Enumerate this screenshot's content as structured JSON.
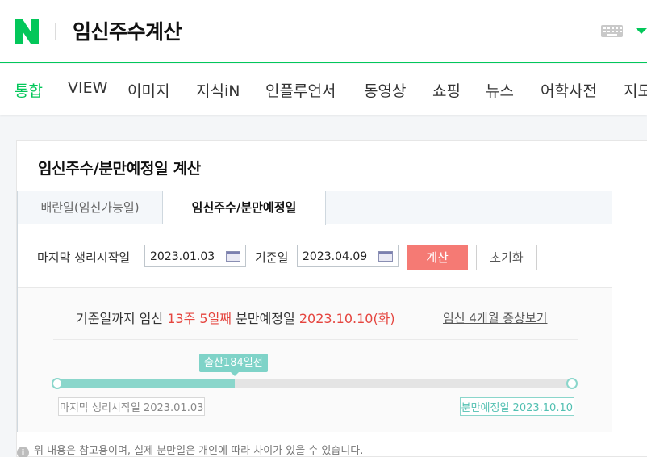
{
  "header": {
    "logo": "N",
    "query": "임신주수계산"
  },
  "tabs": [
    "통합",
    "VIEW",
    "이미지",
    "지식iN",
    "인플루언서",
    "동영상",
    "쇼핑",
    "뉴스",
    "어학사전",
    "지도"
  ],
  "card": {
    "title": "임신주수/분만예정일 계산",
    "widget_tabs": [
      "배란일(임신가능일)",
      "임신주수/분만예정일"
    ],
    "last_period_label": "마지막 생리시작일",
    "last_period_value": "2023.01.03",
    "base_date_label": "기준일",
    "base_date_value": "2023.04.09",
    "calc_button": "계산",
    "reset_button": "초기화",
    "result": {
      "prefix": "기준일까지 임신",
      "weeks": "13주 5일째",
      "due_label": "분만예정일",
      "due_date": "2023.10.10(화)",
      "link": "임신 4개월 증상보기"
    },
    "progress": {
      "bubble": "출산184일전",
      "fraction": 0.345,
      "start_label": "마지막 생리시작일 2023.01.03",
      "end_label": "분만예정일 2023.10.10"
    },
    "note": "위 내용은 참고용이며, 실제 분만일은 개인에 따라 차이가 있을 수 있습니다."
  },
  "colors": {
    "brand": "#03c75a",
    "accent": "#e5453f",
    "teal": "#8ad6cb"
  }
}
